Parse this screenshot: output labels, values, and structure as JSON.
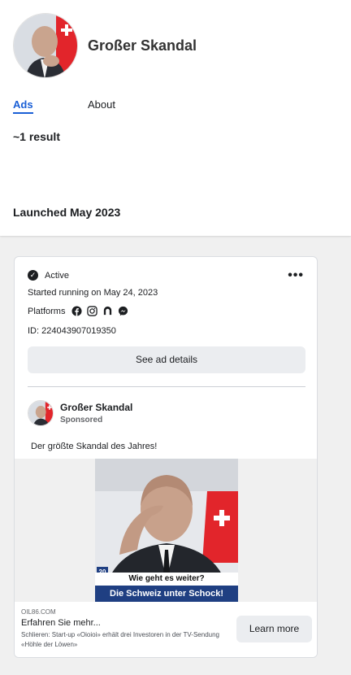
{
  "profile": {
    "name": "Großer Skandal",
    "avatar_icon": "person-portrait-icon"
  },
  "tabs": [
    {
      "label": "Ads",
      "active": true
    },
    {
      "label": "About",
      "active": false
    }
  ],
  "results": {
    "count_label": "~1 result",
    "launched_label": "Launched May 2023"
  },
  "ad_card": {
    "status": "Active",
    "more_label": "•••",
    "started": "Started running on May 24, 2023",
    "platforms_label": "Platforms",
    "platform_icons": [
      "facebook-icon",
      "instagram-icon",
      "audience-network-icon",
      "messenger-icon"
    ],
    "id_label": "ID: 224043907019350",
    "see_details_label": "See ad details",
    "advertiser": {
      "name": "Großer Skandal",
      "sponsored": "Sponsored"
    },
    "body_text": "Der größte Skandal des Jahres!",
    "creative": {
      "badge": "20",
      "caption_top": "Wie geht es weiter?",
      "caption_bottom": "Die Schweiz unter Schock!"
    },
    "footer": {
      "domain": "OIL86.COM",
      "headline": "Erfahren Sie mehr...",
      "description": "Schlieren: Start-up «Oioioi» erhält drei Investoren in der TV-Sendung «Höhle der Löwen»",
      "cta_label": "Learn more"
    }
  },
  "colors": {
    "accent": "#1a5fd6",
    "flag_red": "#e2252b",
    "caption_blue": "#1f3f82"
  }
}
